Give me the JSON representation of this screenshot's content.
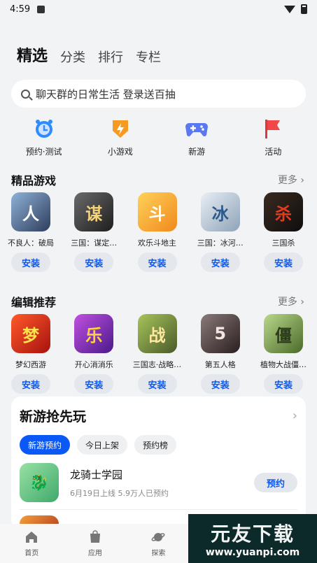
{
  "status": {
    "time": "4:59"
  },
  "tabs": [
    {
      "label": "精选"
    },
    {
      "label": "分类"
    },
    {
      "label": "排行"
    },
    {
      "label": "专栏"
    }
  ],
  "search": {
    "placeholder": "聊天群的日常生活 登录送百抽"
  },
  "quick": [
    {
      "label": "预约·测试",
      "icon": "clock-icon",
      "color": "#2f8cff"
    },
    {
      "label": "小游戏",
      "icon": "lightning-shield-icon",
      "color": "#f59b22"
    },
    {
      "label": "新游",
      "icon": "gamepad-icon",
      "color": "#5a78f0"
    },
    {
      "label": "活动",
      "icon": "flag-icon",
      "color": "#f04848"
    }
  ],
  "featured": {
    "title": "精品游戏",
    "more": "更多",
    "apps": [
      {
        "name": "不良人：破局",
        "glyph": "人",
        "bg": "#3a4a6a",
        "install": "安装"
      },
      {
        "name": "三国：谋定…",
        "glyph": "谋",
        "bg": "#2b2b2b",
        "install": "安装"
      },
      {
        "name": "欢乐斗地主",
        "glyph": "斗",
        "bg": "#f6a623",
        "install": "安装"
      },
      {
        "name": "三国：冰河…",
        "glyph": "冰",
        "bg": "#c0ccd8",
        "install": "安装"
      },
      {
        "name": "三国杀",
        "glyph": "杀",
        "bg": "#1a1a1a",
        "install": "安装"
      }
    ]
  },
  "editor": {
    "title": "编辑推荐",
    "more": "更多",
    "apps": [
      {
        "name": "梦幻西游",
        "glyph": "梦",
        "bg": "#c41b1b",
        "install": "安装"
      },
      {
        "name": "开心消消乐",
        "glyph": "乐",
        "bg": "#8a3dc9",
        "install": "安装"
      },
      {
        "name": "三国志·战略…",
        "glyph": "战",
        "bg": "#6b8a3a",
        "install": "安装"
      },
      {
        "name": "第五人格",
        "glyph": "5",
        "bg": "#4a3a3a",
        "install": "安装"
      },
      {
        "name": "植物大战僵…",
        "glyph": "僵",
        "bg": "#5c7a3a",
        "install": "安装"
      }
    ]
  },
  "newgames": {
    "title": "新游抢先玩",
    "chips": [
      {
        "label": "新游预约"
      },
      {
        "label": "今日上架"
      },
      {
        "label": "预约榜"
      }
    ],
    "item": {
      "name": "龙骑士学园",
      "meta": "6月19日上线  5.9万人已预约",
      "button": "预约"
    }
  },
  "bottomnav": [
    {
      "label": "首页",
      "icon": "home-icon"
    },
    {
      "label": "应用",
      "icon": "apps-icon"
    },
    {
      "label": "探索",
      "icon": "planet-icon"
    }
  ],
  "watermark": {
    "line1": "元友下载",
    "line2": "www.yuanpi.com"
  },
  "colors": {
    "accent": "#0a59f7",
    "background": "#f1f3f5"
  }
}
